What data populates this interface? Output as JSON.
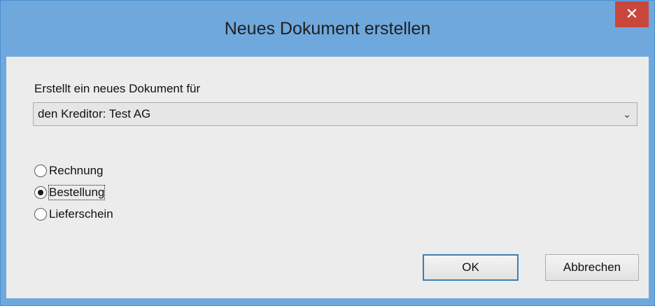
{
  "window": {
    "title": "Neues Dokument erstellen",
    "close_label": "✕"
  },
  "form": {
    "prompt": "Erstellt ein neues Dokument für",
    "target_select": {
      "value": "den Kreditor: Test AG",
      "icon": "chevron-down-icon"
    },
    "document_types": [
      {
        "label": "Rechnung",
        "checked": false
      },
      {
        "label": "Bestellung",
        "checked": true
      },
      {
        "label": "Lieferschein",
        "checked": false
      }
    ]
  },
  "buttons": {
    "ok_label": "OK",
    "cancel_label": "Abbrechen"
  },
  "colors": {
    "titlebar": "#6fa8dc",
    "close_button": "#c9463d",
    "client_bg": "#ececec",
    "default_button_border": "#3c7fb1"
  }
}
